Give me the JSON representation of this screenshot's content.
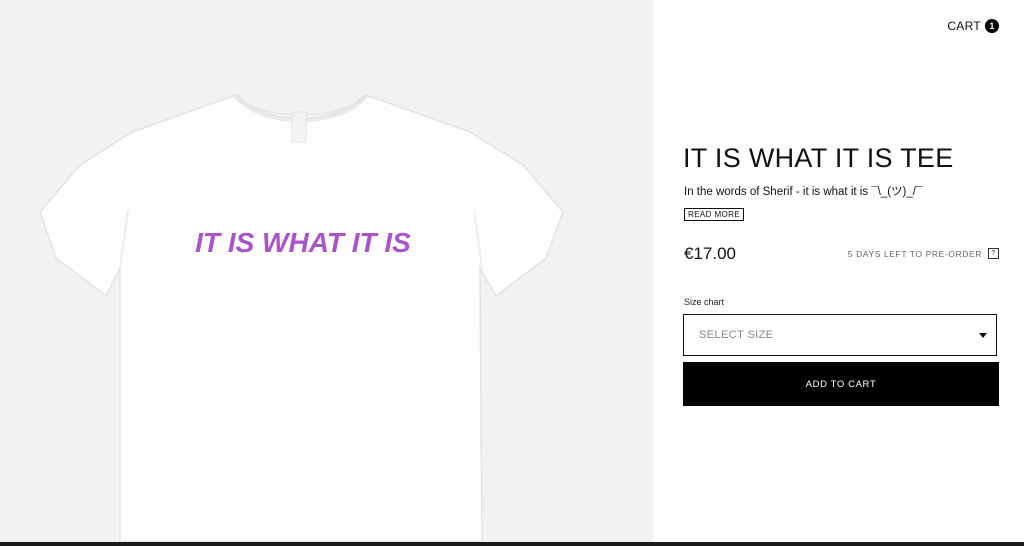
{
  "header": {
    "cart_label": "CART",
    "cart_count": "1"
  },
  "product": {
    "title": "IT IS WHAT IT IS TEE",
    "description": "In the words of Sherif - it is what it is ¯\\_(ツ)_/¯",
    "read_more_label": "READ MORE",
    "price": "€17.00",
    "preorder_text": "5 DAYS LEFT TO PRE-ORDER",
    "help_icon": "?",
    "size_chart_label": "Size chart",
    "size_select_value": "SELECT SIZE",
    "add_to_cart_label": "ADD TO CART",
    "shirt_print": "IT IS WHAT IT IS",
    "shirt_print_color": "#a855c8"
  },
  "icons": {
    "dropdown": "chevron-down-icon",
    "help": "question-mark-icon"
  }
}
